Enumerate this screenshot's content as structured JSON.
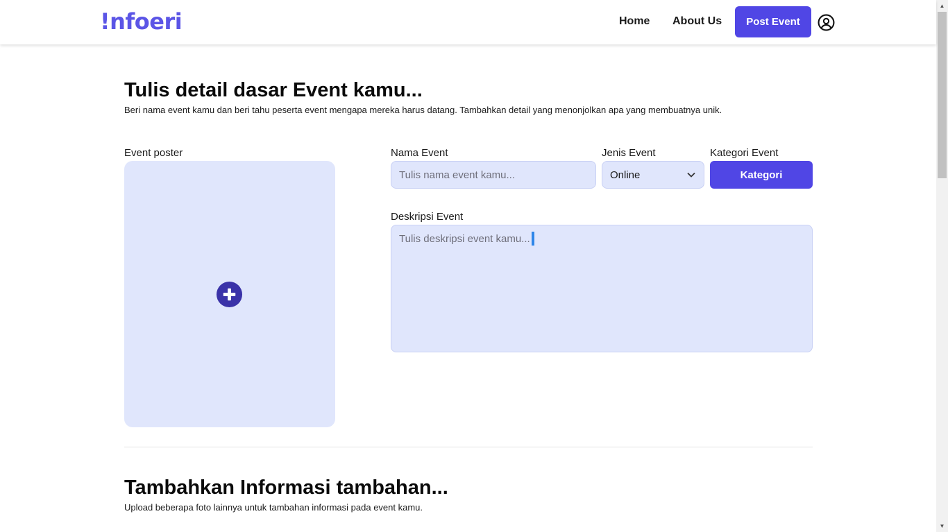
{
  "header": {
    "logo": "!nfoeri",
    "nav": {
      "home": "Home",
      "about": "About Us",
      "post_event": "Post Event"
    },
    "profile_icon": "user-circle-icon"
  },
  "section_basic": {
    "title": "Tulis detail dasar Event kamu...",
    "subtitle": "Beri nama event kamu dan beri tahu peserta event mengapa mereka harus datang. Tambahkan detail yang menonjolkan apa yang membuatnya unik.",
    "poster": {
      "label": "Event poster",
      "icon": "plus-circle-icon"
    },
    "nama_event": {
      "label": "Nama Event",
      "placeholder": "Tulis nama event kamu...",
      "value": ""
    },
    "jenis_event": {
      "label": "Jenis Event",
      "selected": "Online",
      "icon": "chevron-down-icon"
    },
    "kategori_event": {
      "label": "Kategori Event",
      "button": "Kategori"
    },
    "deskripsi_event": {
      "label": "Deskripsi Event",
      "placeholder": "Tulis deskripsi event kamu...",
      "value": ""
    }
  },
  "section_additional": {
    "title": "Tambahkan Informasi tambahan...",
    "subtitle": "Upload beberapa foto lainnya untuk tambahan informasi pada event kamu."
  },
  "colors": {
    "brand": "#5b55e6",
    "primary_button": "#5046e5",
    "field_bg": "#e0e6fc",
    "plus_icon": "#3a32a8"
  }
}
